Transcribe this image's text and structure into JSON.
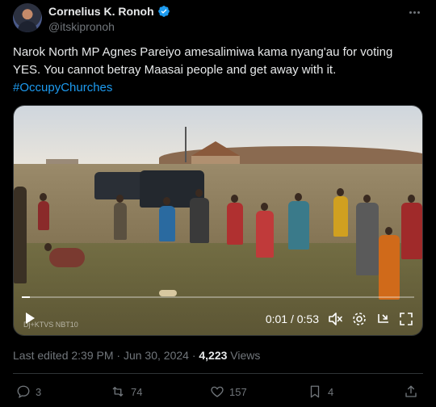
{
  "author": {
    "display_name": "Cornelius K. Ronoh",
    "handle": "@itskipronoh"
  },
  "tweet": {
    "line1": "Narok North MP Agnes Pareiyo amesalimiwa kama nyang'au for voting",
    "line2": "YES. You cannot betray Maasai people and get away with it.",
    "hashtag": "#OccupyChurches"
  },
  "video": {
    "current_time": "0:01",
    "separator": " / ",
    "duration": "0:53",
    "progress_fraction": 0.02,
    "watermark": "Dj+KTVS NBT10"
  },
  "meta": {
    "edited_label": "Last edited 2:39 PM · Jun 30, 2024 · ",
    "views_count": "4,223",
    "views_label": " Views"
  },
  "actions": {
    "replies": "3",
    "retweets": "74",
    "likes": "157",
    "bookmarks": "4"
  },
  "colors": {
    "accent": "#1d9bf0",
    "background": "#000000",
    "secondary_text": "#71767b"
  }
}
